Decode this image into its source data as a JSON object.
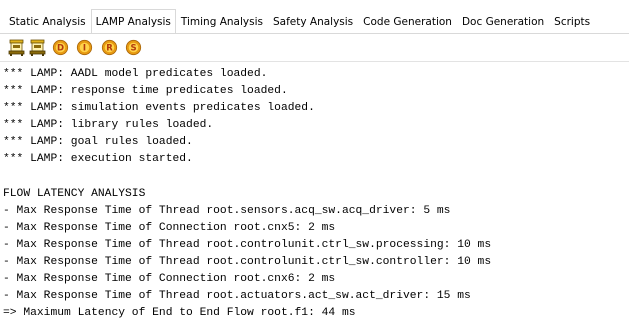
{
  "tabs": [
    {
      "label": "Static Analysis",
      "active": false
    },
    {
      "label": "LAMP Analysis",
      "active": true
    },
    {
      "label": "Timing Analysis",
      "active": false
    },
    {
      "label": "Safety Analysis",
      "active": false
    },
    {
      "label": "Code Generation",
      "active": false
    },
    {
      "label": "Doc Generation",
      "active": false
    },
    {
      "label": "Scripts",
      "active": false
    }
  ],
  "toolbar": {
    "buttons": [
      {
        "icon": "load-rules-icon",
        "letter": ""
      },
      {
        "icon": "load-rules-alt-icon",
        "letter": ""
      },
      {
        "icon": "d-ball-icon",
        "letter": "D"
      },
      {
        "icon": "i-ball-icon",
        "letter": "I"
      },
      {
        "icon": "r-ball-icon",
        "letter": "R"
      },
      {
        "icon": "s-ball-icon",
        "letter": "S"
      }
    ],
    "colors": {
      "machine_body": "#8a6a0a",
      "machine_top": "#e0b21a",
      "ball_outer": "#e79a12",
      "ball_inner": "#ffd34a",
      "ball_letter": "#b3390d"
    }
  },
  "console": {
    "lines": [
      "*** LAMP: AADL model predicates loaded.",
      "*** LAMP: response time predicates loaded.",
      "*** LAMP: simulation events predicates loaded.",
      "*** LAMP: library rules loaded.",
      "*** LAMP: goal rules loaded.",
      "*** LAMP: execution started.",
      "",
      "FLOW LATENCY ANALYSIS",
      "- Max Response Time of Thread root.sensors.acq_sw.acq_driver: 5 ms",
      "- Max Response Time of Connection root.cnx5: 2 ms",
      "- Max Response Time of Thread root.controlunit.ctrl_sw.processing: 10 ms",
      "- Max Response Time of Thread root.controlunit.ctrl_sw.controller: 10 ms",
      "- Max Response Time of Connection root.cnx6: 2 ms",
      "- Max Response Time of Thread root.actuators.act_sw.act_driver: 15 ms",
      "=> Maximum Latency of End to End Flow root.f1: 44 ms"
    ]
  }
}
